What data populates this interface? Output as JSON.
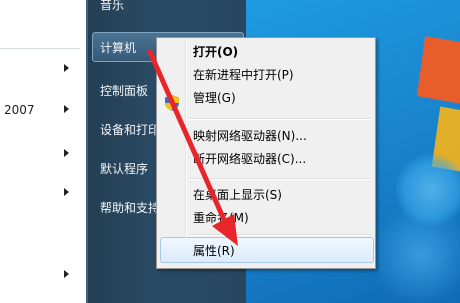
{
  "left_panel": {
    "year": "2007"
  },
  "start_menu": {
    "items": [
      {
        "label": "音乐"
      },
      {
        "label": "计算机"
      },
      {
        "label": "控制面板"
      },
      {
        "label": "设备和打印"
      },
      {
        "label": "默认程序"
      },
      {
        "label": "帮助和支持"
      }
    ]
  },
  "context_menu": {
    "items": [
      {
        "label": "打开(O)"
      },
      {
        "label": "在新进程中打开(P)"
      },
      {
        "label": "管理(G)"
      },
      {
        "label": "映射网络驱动器(N)..."
      },
      {
        "label": "断开网络驱动器(C)..."
      },
      {
        "label": "在桌面上显示(S)"
      },
      {
        "label": "重命名(M)"
      },
      {
        "label": "属性(R)"
      }
    ]
  },
  "colors": {
    "annotation_arrow": "#e8262a",
    "start_menu_bg": "#284660",
    "context_menu_bg": "#f0f0f0",
    "hover_bg": "#dcebfc"
  }
}
